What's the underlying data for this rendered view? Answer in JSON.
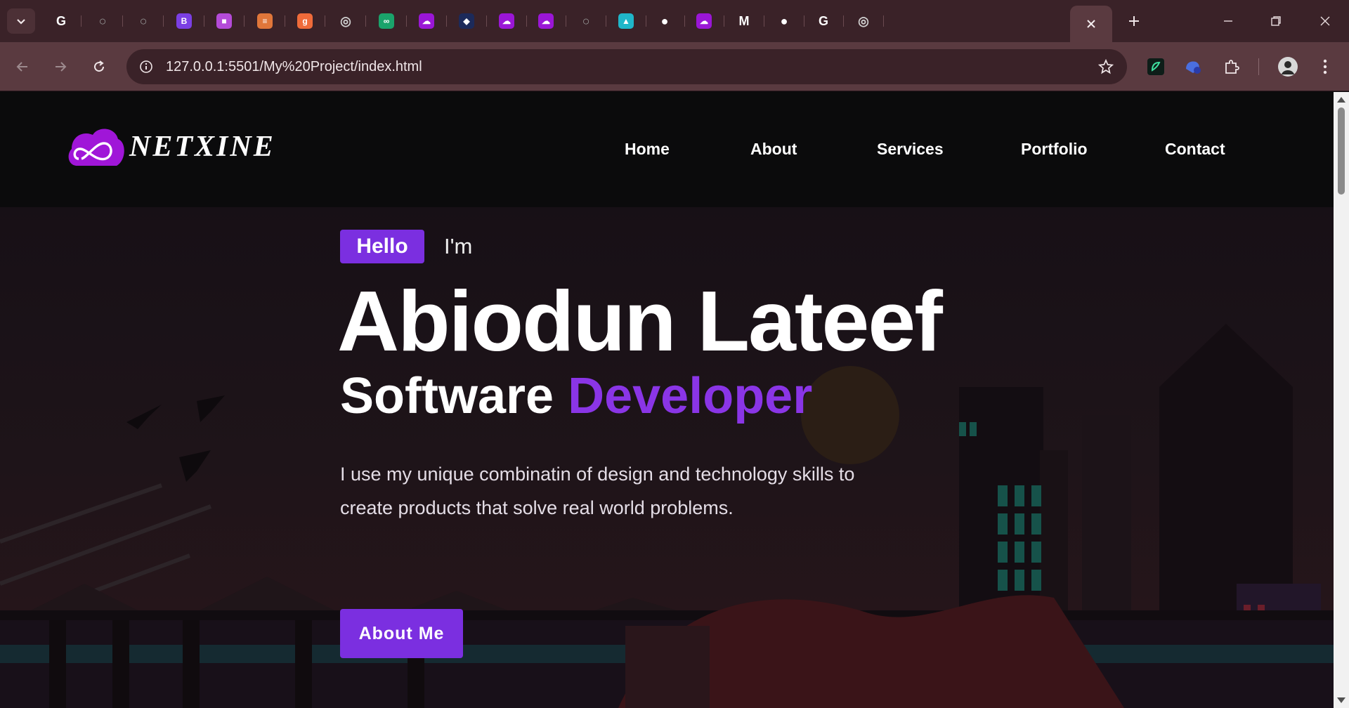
{
  "browser": {
    "tabs": [
      {
        "icon": "google-icon",
        "color": "#ffffff"
      },
      {
        "icon": "globe-icon",
        "color": "#9a9a9a"
      },
      {
        "icon": "globe-icon",
        "color": "#9a9a9a"
      },
      {
        "icon": "bootstrap-icon",
        "color": "#7b3fe4"
      },
      {
        "icon": "cube-icon",
        "color": "#b44bd8"
      },
      {
        "icon": "bars-icon",
        "color": "#e0763a"
      },
      {
        "icon": "g-icon",
        "color": "#ef6b3a"
      },
      {
        "icon": "chrome-icon",
        "color": "#cfcfcf"
      },
      {
        "icon": "infinity-icon",
        "color": "#1aa36b"
      },
      {
        "icon": "cloud-purple-icon",
        "color": "#9a16d6"
      },
      {
        "icon": "app-icon",
        "color": "#1c2a5a"
      },
      {
        "icon": "cloud-purple-icon",
        "color": "#9a16d6"
      },
      {
        "icon": "cloud-purple-icon",
        "color": "#9a16d6"
      },
      {
        "icon": "globe-icon",
        "color": "#9a9a9a"
      },
      {
        "icon": "cube-color-icon",
        "color": "#1fb6c9"
      },
      {
        "icon": "github-icon",
        "color": "#ffffff"
      },
      {
        "icon": "cloud-purple-icon",
        "color": "#9a16d6"
      },
      {
        "icon": "medium-icon",
        "color": "#ffffff"
      },
      {
        "icon": "github-icon",
        "color": "#ffffff"
      },
      {
        "icon": "google-icon",
        "color": "#ffffff"
      },
      {
        "icon": "chrome-icon",
        "color": "#cfcfcf"
      }
    ],
    "url": "127.0.0.1:5501/My%20Project/index.html"
  },
  "site": {
    "logo_text": "NETXINE",
    "nav": [
      "Home",
      "About",
      "Services",
      "Portfolio",
      "Contact"
    ],
    "hero": {
      "badge": "Hello",
      "intro": "I'm",
      "name": "Abiodun Lateef",
      "role_plain": "Software",
      "role_accent": "Developer",
      "description": "I use my unique combinatin of design and technology skills to create products that solve real world problems.",
      "cta": "About Me"
    }
  },
  "colors": {
    "accent": "#7b2fe0",
    "accent_text": "#8a35e6",
    "header_bg": "#0b0b0c",
    "tabstrip": "#3a2228",
    "toolbar": "#5a3a40"
  }
}
